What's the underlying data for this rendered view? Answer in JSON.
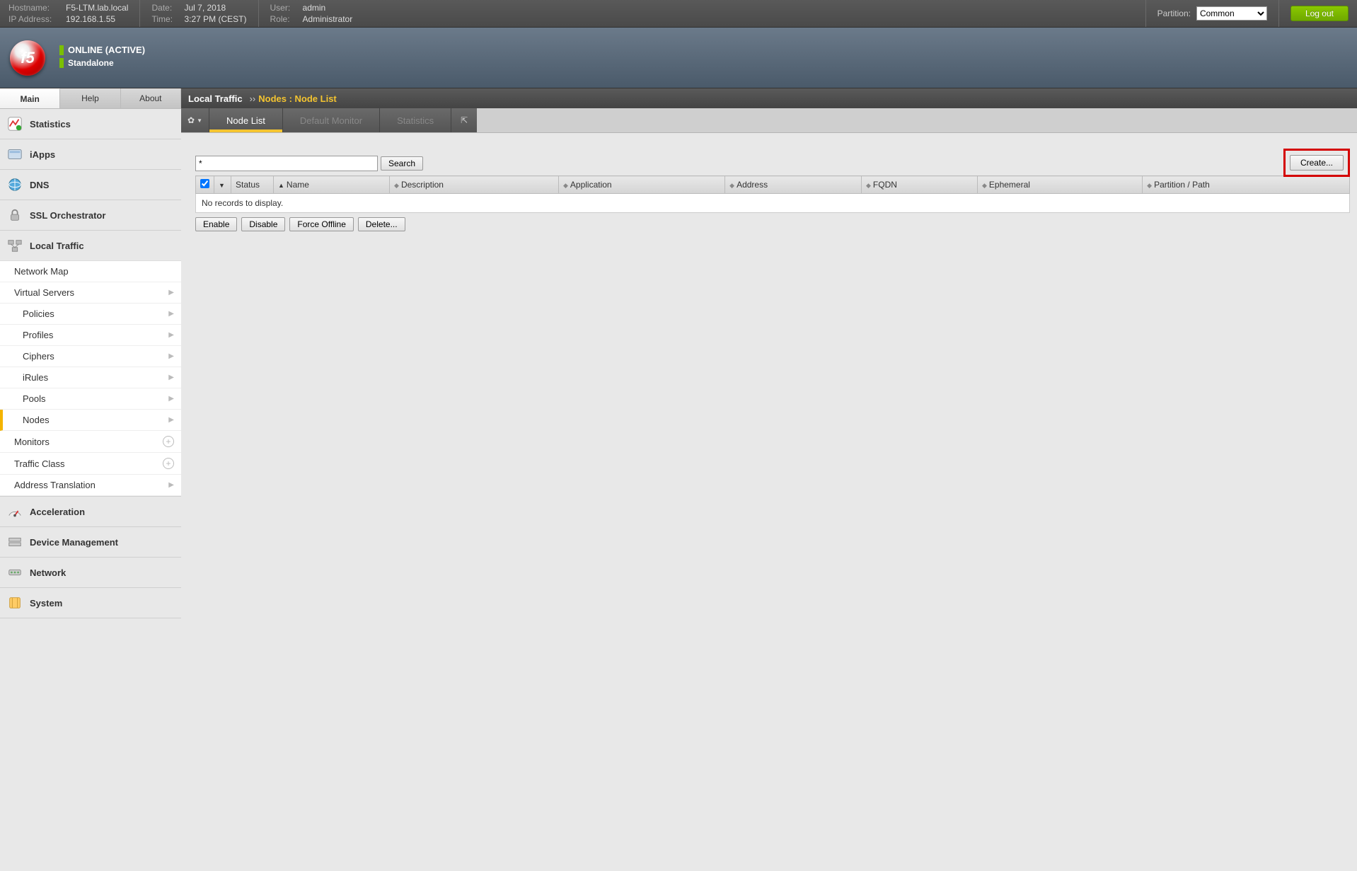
{
  "topbar": {
    "hostname_label": "Hostname:",
    "hostname": "F5-LTM.lab.local",
    "ip_label": "IP Address:",
    "ip": "192.168.1.55",
    "date_label": "Date:",
    "date": "Jul 7, 2018",
    "time_label": "Time:",
    "time": "3:27 PM (CEST)",
    "user_label": "User:",
    "user": "admin",
    "role_label": "Role:",
    "role": "Administrator",
    "partition_label": "Partition:",
    "partition_value": "Common",
    "logout": "Log out"
  },
  "status": {
    "online": "ONLINE (ACTIVE)",
    "mode": "Standalone",
    "logo_text": "f5"
  },
  "left_tabs": {
    "main": "Main",
    "help": "Help",
    "about": "About"
  },
  "nav": {
    "statistics": "Statistics",
    "iapps": "iApps",
    "dns": "DNS",
    "ssl": "SSL Orchestrator",
    "local_traffic": "Local Traffic",
    "lt_items": {
      "network_map": "Network Map",
      "virtual_servers": "Virtual Servers",
      "policies": "Policies",
      "profiles": "Profiles",
      "ciphers": "Ciphers",
      "irules": "iRules",
      "pools": "Pools",
      "nodes": "Nodes",
      "monitors": "Monitors",
      "traffic_class": "Traffic Class",
      "address_translation": "Address Translation"
    },
    "acceleration": "Acceleration",
    "device_mgmt": "Device Management",
    "network": "Network",
    "system": "System"
  },
  "breadcrumb": {
    "section": "Local Traffic",
    "sep": "››",
    "page": "Nodes : Node List"
  },
  "subtabs": {
    "node_list": "Node List",
    "default_monitor": "Default Monitor",
    "statistics": "Statistics"
  },
  "search": {
    "value": "*",
    "button": "Search",
    "create": "Create..."
  },
  "table": {
    "cols": {
      "status": "Status",
      "name": "Name",
      "description": "Description",
      "application": "Application",
      "address": "Address",
      "fqdn": "FQDN",
      "ephemeral": "Ephemeral",
      "partition": "Partition / Path"
    },
    "empty": "No records to display."
  },
  "actions": {
    "enable": "Enable",
    "disable": "Disable",
    "force_offline": "Force Offline",
    "delete": "Delete..."
  }
}
